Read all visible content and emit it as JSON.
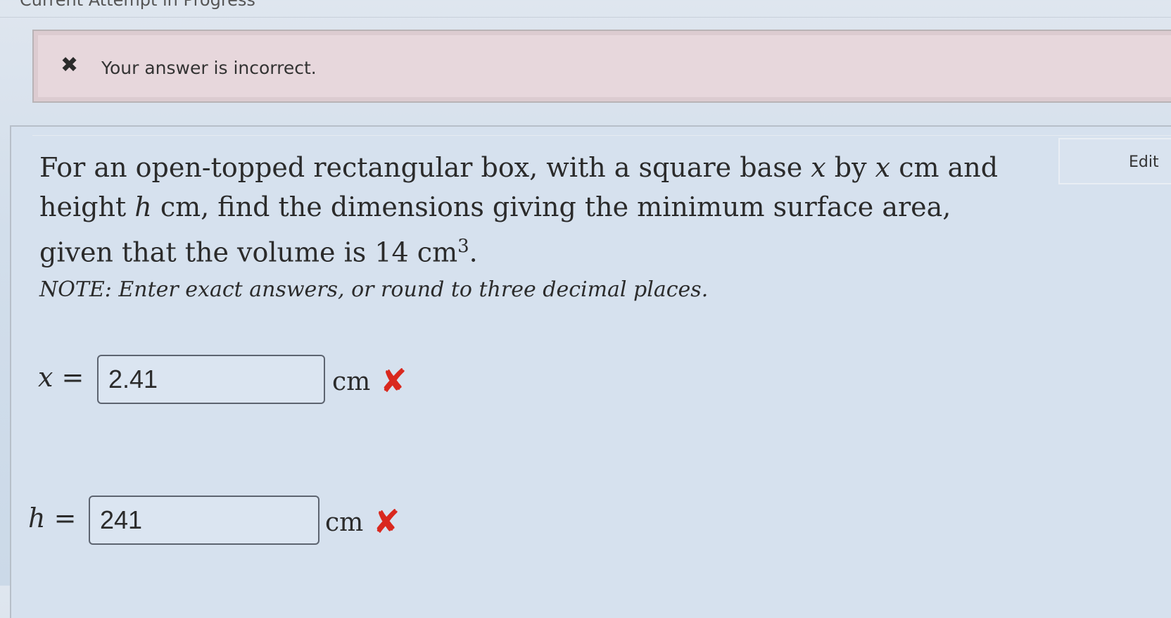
{
  "header": {
    "title": "Current Attempt in Progress"
  },
  "alert": {
    "icon": "close-icon",
    "icon_glyph": "✖",
    "message": "Your answer is incorrect."
  },
  "toolbar": {
    "edit_label": "Edit"
  },
  "question": {
    "line1_a": "For an open-topped rectangular box, with a square base ",
    "line1_var1": "x",
    "line1_b": " by ",
    "line1_var2": "x",
    "line1_c": " cm and",
    "line2_a": "height ",
    "line2_var": "h",
    "line2_b": " cm, find the dimensions giving the minimum surface area,",
    "line3_a": "given that the volume is 14 cm",
    "line3_sup": "3",
    "line3_b": ".",
    "note": "NOTE: Enter exact answers, or round to three decimal places."
  },
  "answers": [
    {
      "variable": "x",
      "equals": " =",
      "value": "2.41",
      "unit": "cm",
      "status": "incorrect",
      "status_icon": "✘"
    },
    {
      "variable": "h",
      "equals": " =",
      "value": "241",
      "unit": "cm",
      "status": "incorrect",
      "status_icon": "✘"
    }
  ],
  "colors": {
    "alert_background": "#e7d7dc",
    "incorrect_mark": "#d9281e",
    "page_background": "#d2deeb"
  }
}
